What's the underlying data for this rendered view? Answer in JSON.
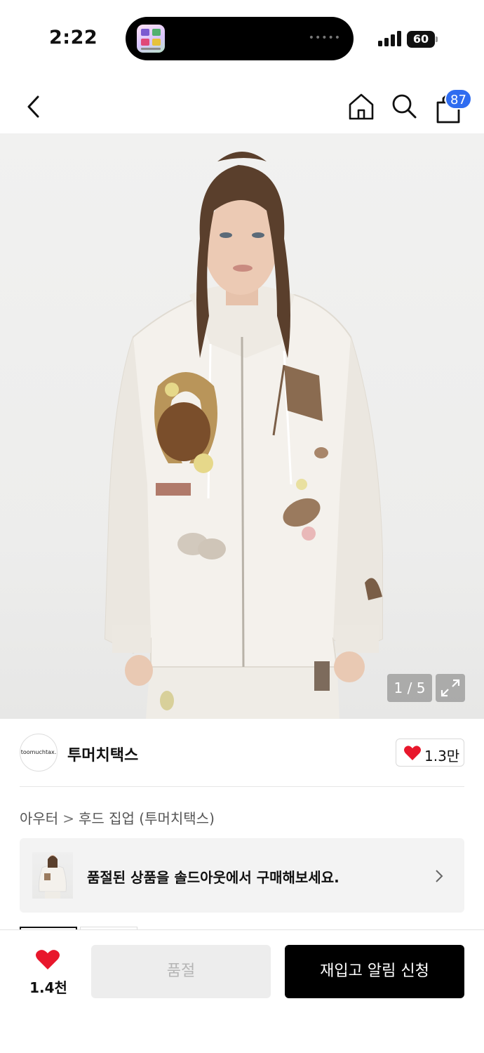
{
  "status_bar": {
    "time": "2:22",
    "battery": "60",
    "island_dots": "•••••"
  },
  "nav": {
    "cart_badge": "87"
  },
  "image": {
    "counter": "1 / 5"
  },
  "brand": {
    "logo_text": "toomuchtax.",
    "name": "투머치택스",
    "like_count": "1.3만"
  },
  "breadcrumb": {
    "category": "아우터",
    "separator": ">",
    "subcategory": "후드 집업 (투머치택스)"
  },
  "soldout_banner": {
    "text": "품절된 상품을 솔드아웃에서 구매해보세요."
  },
  "bottom_bar": {
    "wish_count": "1.4천",
    "soldout_label": "품절",
    "restock_label": "재입고 알림 신청"
  },
  "colors": {
    "accent_red": "#e8172c",
    "badge_blue": "#2f6cf0",
    "primary_black": "#000000",
    "disabled_gray": "#ededed"
  },
  "icons": [
    "back-icon",
    "home-icon",
    "search-icon",
    "shopping-bag-icon",
    "expand-icon",
    "heart-icon",
    "chevron-right-icon"
  ]
}
